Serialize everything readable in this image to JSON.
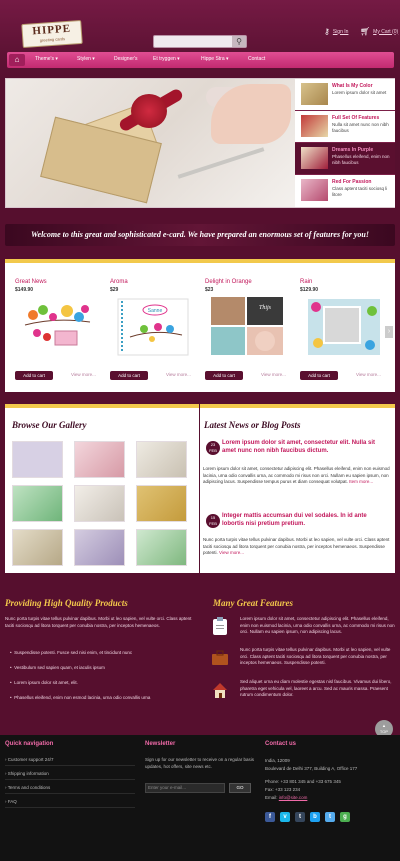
{
  "header": {
    "logo_title": "HIPPE",
    "logo_subtitle": "greeting cards",
    "sign_in": "Sign In",
    "my_cart": "My Cart (0)",
    "search_placeholder": ""
  },
  "nav": {
    "items": [
      "Theme's",
      "Stylen",
      "Designer's",
      "Et tryggen",
      "Hippe Stra",
      "Contact"
    ]
  },
  "slider_items": [
    {
      "title": "What Is My Color",
      "desc": "Lorem ipsum dolor sit amet"
    },
    {
      "title": "Full Set Of Features",
      "desc": "Nulla sit amet nunc non nibh faucibus"
    },
    {
      "title": "Dreams In Purple",
      "desc": "Phasellus eleifend, enim non nibh faucibus"
    },
    {
      "title": "Red For Passion",
      "desc": "Class aptent taciti sociosq li litore"
    }
  ],
  "welcome": "Welcome to this great and sophisticated e-card. We have prepared an enormous set of features for you!",
  "products": [
    {
      "name": "Great News",
      "price": "$149.90",
      "cart": "Add to cart",
      "more": "View more..."
    },
    {
      "name": "Aroma",
      "price": "$29",
      "cart": "Add to cart",
      "more": "View more..."
    },
    {
      "name": "Delight in Orange",
      "price": "$23",
      "cart": "Add to cart",
      "more": "View more..."
    },
    {
      "name": "Rain",
      "price": "$129.90",
      "cart": "Add to cart",
      "more": "View more..."
    }
  ],
  "product_image_text": {
    "aroma": "Sanne",
    "delight": "Thijs"
  },
  "gallery": {
    "title": "Browse Our Gallery"
  },
  "news": {
    "title": "Latest News or Blog Posts",
    "posts": [
      {
        "day": "23",
        "month": "FEB",
        "headline": "Lorem ipsum dolor sit amet, consectetur elit. Nulla sit amet nunc non nibh faucibus dictum.",
        "body": "Lorem ipsum dolor sit amet, consectetur adipiscing elit. Phasellus eleifend, enim non euismod lacinia, urna odio convallis urna, ac commodo mi risus non orci. Nullam eu sapien ipsum, non adipiscing lacus. Suspendisse tempus purus et diam consequat volutpat.",
        "more": "Item more..."
      },
      {
        "day": "15",
        "month": "FEB",
        "headline": "Integer mattis accumsan dui vel sodales. In id ante lobortis nisi pretium pretium.",
        "body": "Nunc porta turpis vitae tellus pulvinar dapibus. Morbi ut leo sapien, vel vulte orci. Class aptent taciti sociosqu ad litora torquent per conubia nostra, per inceptos hemenaeos. Suspendisse potenti.",
        "more": "View more..."
      }
    ]
  },
  "quality": {
    "title": "Providing High Quality Products",
    "text": "Nunc porta turpis vitae tellus pulvinar dapibus. Morbi ut leo sapien, vel vulte orci. Class aptent taciti sociosqu ad litora torquent per conubia nostra, per inceptos hemenaeos.",
    "bullets": [
      "Suspendisse potenti. Fusce sed nisi enim, et tincidunt nunc",
      "Vestibulum sed sapien quam, et iaculis ipsum",
      "Lorem ipsum dolor sit amet, elit.",
      "Phasellus eleifend, enim non esmod lacinia, urna odio convallis urna"
    ]
  },
  "features": {
    "title": "Many Great Features",
    "items": [
      "Lorem ipsum dolor sit amet, consectetur adipiscing elit. Phasellus eleifend, enim non euismod lacinia, urna odio convallis urna, ac commodo mi risus non orci. Nullam eu sapien ipsum, non adipiscing lacus.",
      "Nunc porta turpis vitae tellus pulvinar dapibus. Morbi ut leo sapien, vel vulte orci. Class aptent taciti sociosqu ad litora torquent per conubia nostra, per inceptos hemenaeos. Suspendisse potenti.",
      "Sed aliquet urna eu diam molestie egestas nisl faucibus. Vivamus dui libero, pharetra eget vehicula vel, laoreet a arcu. Sed ac mauris massa. Praesent rutrum condimentum dolor."
    ]
  },
  "footer": {
    "quick_title": "Quick navigation",
    "quick_links": [
      "Customer support 24/7",
      "Shipping information",
      "Terms and conditions",
      "FAQ"
    ],
    "newsletter_title": "Newsletter",
    "newsletter_text": "Sign up for our newsletter to receive on a regular basis updates, hot offers, site news etc.",
    "newsletter_placeholder": "Enter your e-mail...",
    "newsletter_button": "GO",
    "contact_title": "Contact us",
    "address": [
      "India, 12009",
      "Boulevard de Delhi 377, Building A, Office 177"
    ],
    "phone": "Phone: +33 801 345 and +33 675 345",
    "fax": "Fax: +33 123 234",
    "email_label": "Email:",
    "email": "info@site.com",
    "social": [
      "f",
      "v",
      "t",
      "b",
      "t",
      "g"
    ],
    "top_label": "TOP"
  },
  "colors": {
    "accent": "#c2185b",
    "dark": "#5a0f2f",
    "gold": "#f3c84b"
  }
}
